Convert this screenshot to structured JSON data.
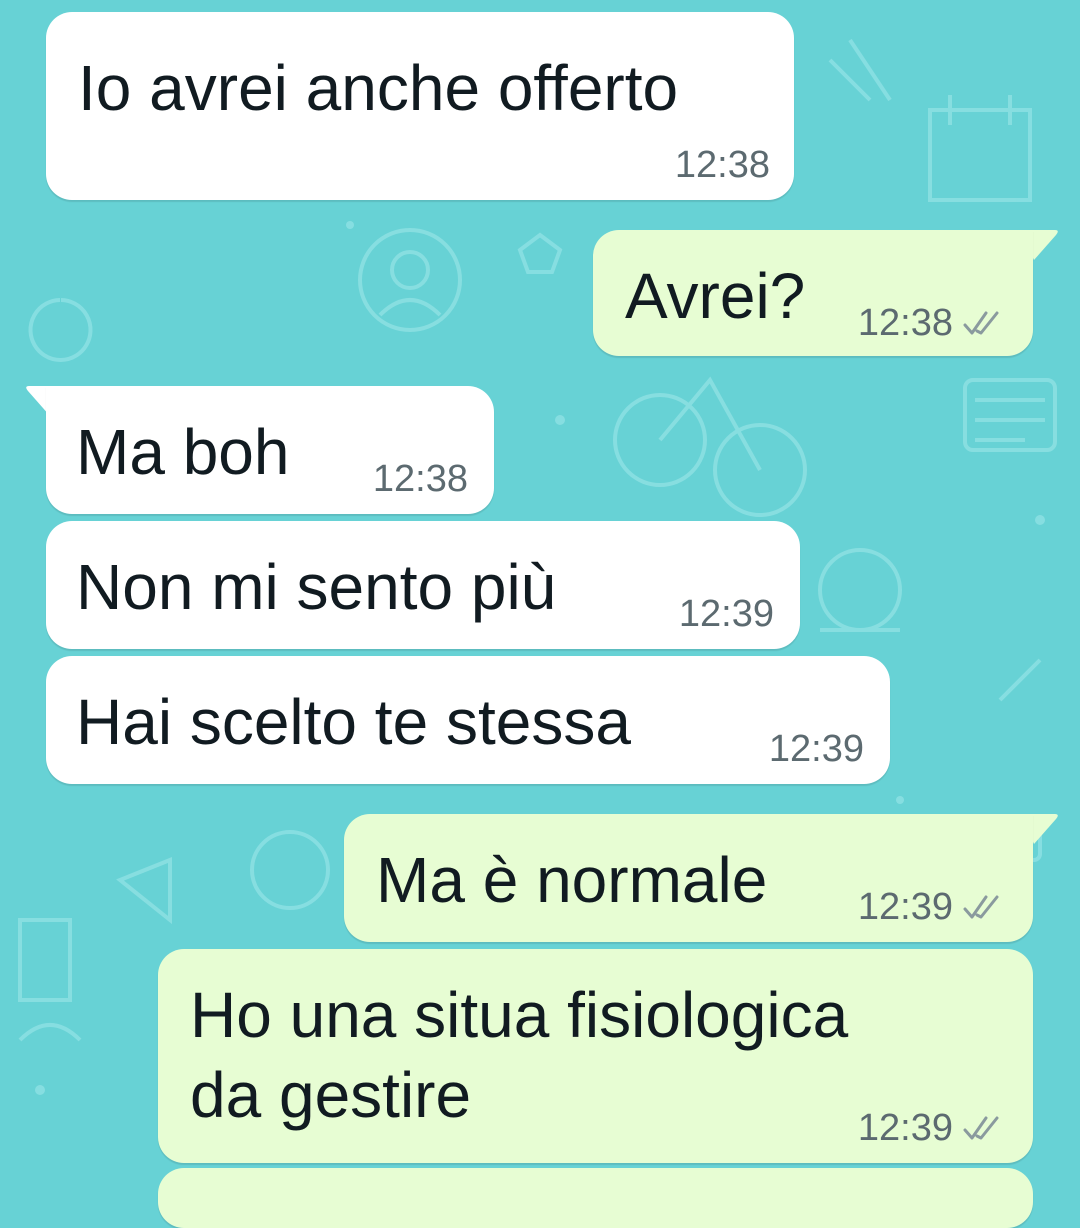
{
  "chat": {
    "messages": [
      {
        "direction": "incoming",
        "text": "Io avrei anche offerto",
        "time": "12:38"
      },
      {
        "direction": "outgoing",
        "text": "Avrei?",
        "time": "12:38",
        "status": "double-check-icon"
      },
      {
        "direction": "incoming",
        "text": "Ma boh",
        "time": "12:38"
      },
      {
        "direction": "incoming",
        "text": "Non mi sento più",
        "time": "12:39"
      },
      {
        "direction": "incoming",
        "text": "Hai scelto te stessa",
        "time": "12:39"
      },
      {
        "direction": "outgoing",
        "text": "Ma è normale",
        "time": "12:39",
        "status": "double-check-icon"
      },
      {
        "direction": "outgoing",
        "text_line1": "Ho una situa fisiologica",
        "text_line2": "da gestire",
        "time": "12:39",
        "status": "double-check-icon"
      }
    ]
  },
  "colors": {
    "wallpaper": "#67d2d5",
    "incoming_bubble": "#ffffff",
    "outgoing_bubble": "#e7fdd3",
    "text": "#111b21",
    "meta": "#5c6a70"
  }
}
